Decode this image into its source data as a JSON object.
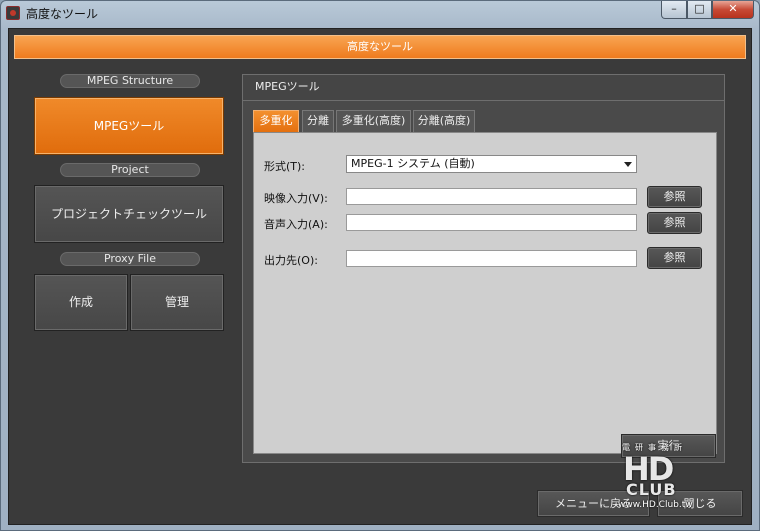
{
  "window": {
    "title": "高度なツール",
    "controls": {
      "minimize": "–",
      "maximize": "□",
      "close": "✕"
    }
  },
  "header": {
    "title": "高度なツール"
  },
  "sidebar": {
    "sections": [
      {
        "label": "MPEG Structure"
      },
      {
        "label": "Project"
      },
      {
        "label": "Proxy File"
      }
    ],
    "mpeg_button": "MPEGツール",
    "project_button": "プロジェクトチェックツール",
    "create_button": "作成",
    "manage_button": "管理"
  },
  "panel": {
    "title": "MPEGツール",
    "tabs": [
      "多重化",
      "分離",
      "多重化(高度)",
      "分離(高度)"
    ],
    "active_tab": 0,
    "format": {
      "label": "形式(T):",
      "value": "MPEG-1 システム (自動)"
    },
    "video_input": {
      "label": "映像入力(V):",
      "value": "",
      "browse": "参照"
    },
    "audio_input": {
      "label": "音声入力(A):",
      "value": "",
      "browse": "参照"
    },
    "output": {
      "label": "出力先(O):",
      "value": "",
      "browse": "参照"
    },
    "execute_button": "実行"
  },
  "footer": {
    "back_button": "メニューに戻る",
    "close_button": "閉じる"
  },
  "watermark": {
    "top": "電研事務所",
    "logo": "HD",
    "club": "CLUB",
    "url": "www.HD.Club.tw"
  },
  "colors": {
    "accent": "#ef7b1e",
    "panel": "#4a4a4a",
    "content": "#cfcfcf"
  }
}
